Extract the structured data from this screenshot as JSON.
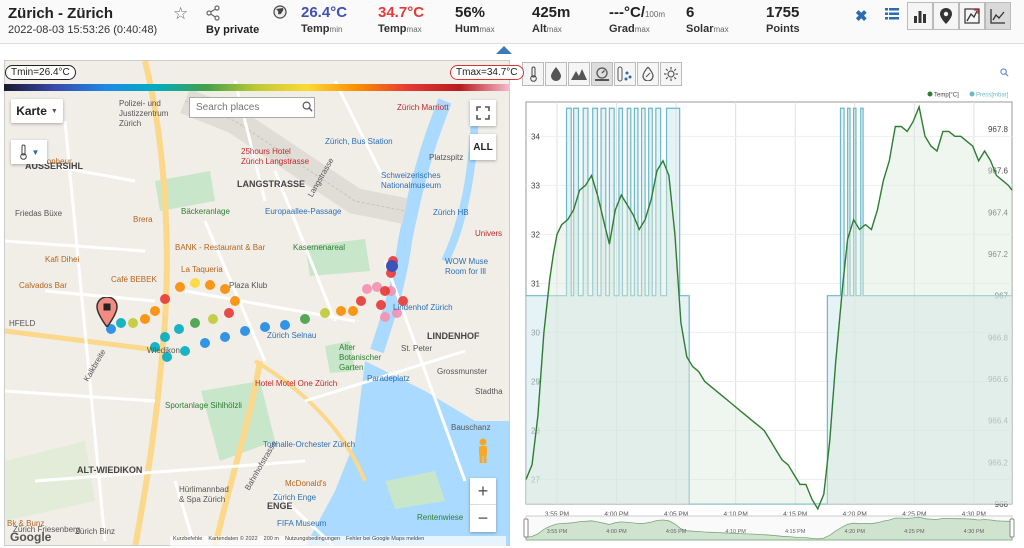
{
  "header": {
    "title": "Zürich - Zürich",
    "date": "2022-08-03 15:53:26 (0:40:48)",
    "by": "By private",
    "stats": [
      {
        "value": "26.4°C",
        "label": "Temp",
        "sub": "min",
        "color": "#3f51b5"
      },
      {
        "value": "34.7°C",
        "label": "Temp",
        "sub": "max",
        "color": "#e53935"
      },
      {
        "value": "56%",
        "label": "Hum",
        "sub": "max",
        "color": "#222222"
      },
      {
        "value": "425m",
        "label": "Alt",
        "sub": "max",
        "color": "#222222"
      },
      {
        "value": "---°C/",
        "unit": "100m",
        "label": "Grad",
        "sub": "max",
        "color": "#222222"
      },
      {
        "value": "6",
        "label": "Solar",
        "sub": "max",
        "color": "#222222"
      },
      {
        "value": "1755",
        "label": "Points",
        "sub": "",
        "color": "#222222"
      }
    ]
  },
  "map": {
    "tmin": "Tmin=26.4°C",
    "tmax": "Tmax=34.7°C",
    "karte_label": "Karte",
    "search_placeholder": "Search places",
    "all_label": "ALL",
    "google_label": "Google",
    "attribution": [
      "Kurzbefehle",
      "Kartendaten © 2022",
      "200 m",
      "Nutzungsbedingungen",
      "Fehler bei Google Maps melden"
    ],
    "labels": [
      {
        "t": "Polizei- und",
        "cls": ""
      },
      {
        "t": "Justizzentrum",
        "cls": ""
      },
      {
        "t": "Zürich",
        "cls": ""
      },
      {
        "t": "Zürich Marriott",
        "cls": "red"
      },
      {
        "t": "Zürich, Bus Station",
        "cls": "blue"
      },
      {
        "t": "Platzspitz",
        "cls": ""
      },
      {
        "t": "25hours Hotel",
        "cls": "red"
      },
      {
        "t": "Zürich Langstrasse",
        "cls": "red"
      },
      {
        "t": "AUSSERSIHL",
        "cls": "bold"
      },
      {
        "t": "LANGSTRASSE",
        "cls": "bold"
      },
      {
        "t": "Schweizerisches",
        "cls": "blue"
      },
      {
        "t": "Nationalmuseum",
        "cls": "blue"
      },
      {
        "t": "Du Bonheur",
        "cls": "poi"
      },
      {
        "t": "Friedas Büxe",
        "cls": ""
      },
      {
        "t": "Bäckeranlage",
        "cls": "green"
      },
      {
        "t": "Europaallee-Passage",
        "cls": "blue"
      },
      {
        "t": "Zürich HB",
        "cls": "blue"
      },
      {
        "t": "Brera",
        "cls": "poi"
      },
      {
        "t": "BANK - Restaurant & Bar",
        "cls": "poi"
      },
      {
        "t": "Kasernenareal",
        "cls": "green"
      },
      {
        "t": "Univers",
        "cls": "red"
      },
      {
        "t": "Kafi Dihei",
        "cls": "poi"
      },
      {
        "t": "La Taqueria",
        "cls": "poi"
      },
      {
        "t": "Café BEBEK",
        "cls": "poi"
      },
      {
        "t": "Plaza Klub",
        "cls": ""
      },
      {
        "t": "WOW Muse",
        "cls": "blue"
      },
      {
        "t": "Room for Ill",
        "cls": "blue"
      },
      {
        "t": "Calvados Bar",
        "cls": "poi"
      },
      {
        "t": "Lindenhof Zürich",
        "cls": "blue"
      },
      {
        "t": "LINDENHOF",
        "cls": "bold"
      },
      {
        "t": "Zürich Selnau",
        "cls": "blue"
      },
      {
        "t": "Alter",
        "cls": "green"
      },
      {
        "t": "Botanischer",
        "cls": "green"
      },
      {
        "t": "Garten",
        "cls": "green"
      },
      {
        "t": "St. Peter",
        "cls": ""
      },
      {
        "t": "Kalkbreite",
        "cls": ""
      },
      {
        "t": "Wiedikon",
        "cls": ""
      },
      {
        "t": "Paradeplatz",
        "cls": "blue"
      },
      {
        "t": "Grossmunster",
        "cls": ""
      },
      {
        "t": "Hotel Motel One Zürich",
        "cls": "red"
      },
      {
        "t": "Sportanlage Sihlhölzli",
        "cls": "green"
      },
      {
        "t": "Bauschanz",
        "cls": ""
      },
      {
        "t": "Tonhalle-Orchester Zürich",
        "cls": "blue"
      },
      {
        "t": "ALT-WIEDIKON",
        "cls": "bold"
      },
      {
        "t": "McDonald's",
        "cls": "poi"
      },
      {
        "t": "Hürlimannbad",
        "cls": ""
      },
      {
        "t": "& Spa Zürich",
        "cls": ""
      },
      {
        "t": "Zürich Enge",
        "cls": "blue"
      },
      {
        "t": "ENGE",
        "cls": "bold"
      },
      {
        "t": "Rentenwiese",
        "cls": "green"
      },
      {
        "t": "Zürich Friesenberg",
        "cls": ""
      },
      {
        "t": "Bk & Bunz",
        "cls": "poi"
      },
      {
        "t": "Zürich Binz",
        "cls": ""
      },
      {
        "t": "FIFA Museum",
        "cls": "blue"
      },
      {
        "t": "Bahnhofstrasse",
        "cls": ""
      },
      {
        "t": "Langstrasse",
        "cls": ""
      },
      {
        "t": "HFELD",
        "cls": ""
      },
      {
        "t": "Stadtha",
        "cls": ""
      }
    ]
  },
  "chart_data": {
    "type": "line",
    "title": "",
    "legend": [
      "Temp[°C]",
      "Press[mbar]"
    ],
    "legend_position": "top-right",
    "series_colors": {
      "temp": "#2e7d32",
      "press": "#6cb8c9"
    },
    "x_ticks": [
      "3:55 PM",
      "4:00 PM",
      "4:05 PM",
      "4:10 PM",
      "4:15 PM",
      "4:20 PM",
      "4:25 PM",
      "4:30 PM"
    ],
    "x_range_minutes": [
      0,
      40.8
    ],
    "y_left": {
      "label": "Temp[°C]",
      "ticks": [
        27,
        28,
        29,
        30,
        31,
        32,
        33,
        34
      ],
      "range": [
        26.5,
        34.7
      ]
    },
    "y_right": {
      "label": "Press[mbar]",
      "ticks": [
        966,
        966.2,
        966.4,
        966.6,
        966.8,
        967,
        967.2,
        967.4,
        967.6,
        967.8
      ],
      "range": [
        966,
        967.93
      ]
    },
    "series": [
      {
        "name": "Temp[°C]",
        "axis": "left",
        "t": [
          0,
          0.5,
          1,
          1.5,
          2,
          2.3,
          2.6,
          3,
          3.5,
          4,
          4.5,
          5,
          5.5,
          6,
          6.5,
          7,
          7.5,
          8,
          8.5,
          9,
          9.5,
          10,
          10.5,
          11,
          11.5,
          12,
          12.5,
          13,
          13.5,
          14,
          14.5,
          15,
          15.5,
          16,
          16.5,
          17,
          17.5,
          18,
          18.5,
          19,
          19.5,
          20,
          20.5,
          21,
          21.5,
          22,
          22.5,
          23,
          23.5,
          24,
          24.5,
          25,
          25.5,
          26,
          26.3,
          26.6,
          27,
          27.5,
          28,
          28.5,
          29,
          29.5,
          30,
          30.5,
          31,
          31.5,
          32,
          32.5,
          33,
          33.5,
          34,
          34.5,
          35,
          35.5,
          36,
          36.5,
          37,
          37.5,
          38,
          38.5,
          39,
          39.5,
          40,
          40.5,
          40.8
        ],
        "v": [
          27.0,
          27.3,
          28.3,
          30.0,
          31.1,
          31.6,
          32.0,
          32.2,
          32.3,
          32.5,
          32.9,
          33.0,
          33.2,
          32.8,
          32.3,
          31.8,
          32.5,
          32.8,
          32.6,
          32.4,
          32.1,
          32.3,
          32.7,
          33.3,
          33.5,
          33.2,
          32.0,
          30.2,
          29.5,
          29.3,
          29.2,
          29.0,
          28.9,
          28.8,
          28.7,
          28.6,
          28.5,
          28.4,
          28.3,
          28.2,
          28.1,
          28.0,
          27.8,
          27.6,
          27.4,
          27.3,
          27.1,
          26.9,
          26.9,
          26.6,
          26.4,
          26.7,
          27.8,
          29.4,
          30.2,
          31.0,
          31.9,
          32.3,
          32.1,
          32.2,
          32.1,
          32.5,
          33.1,
          33.5,
          34.2,
          34.2,
          34.1,
          34.3,
          34.6,
          34.0,
          33.8,
          33.7,
          34.1,
          34.1,
          34.0,
          34.0,
          33.9,
          33.8,
          33.5,
          33.7,
          33.5,
          33.2,
          33.1,
          33.0,
          32.9
        ]
      },
      {
        "name": "Press[mbar]",
        "axis": "right",
        "steps": [
          [
            0,
            967
          ],
          [
            3.3,
            967
          ],
          [
            3.4,
            967.9
          ],
          [
            3.8,
            967
          ],
          [
            4.0,
            967.9
          ],
          [
            4.4,
            967
          ],
          [
            4.8,
            967.9
          ],
          [
            5.2,
            967
          ],
          [
            5.6,
            967.9
          ],
          [
            6.0,
            967
          ],
          [
            6.3,
            967.9
          ],
          [
            6.7,
            967
          ],
          [
            7.0,
            967.9
          ],
          [
            7.4,
            967
          ],
          [
            7.8,
            967.9
          ],
          [
            8.1,
            967
          ],
          [
            8.5,
            967.9
          ],
          [
            8.8,
            967
          ],
          [
            9.1,
            967.9
          ],
          [
            9.4,
            967
          ],
          [
            9.7,
            967.9
          ],
          [
            10.0,
            967
          ],
          [
            10.3,
            967.9
          ],
          [
            10.6,
            967
          ],
          [
            10.9,
            967.9
          ],
          [
            11.3,
            967
          ],
          [
            11.6,
            967
          ],
          [
            11.8,
            967.9
          ],
          [
            12.8,
            967.9
          ],
          [
            12.9,
            967
          ],
          [
            13.6,
            967
          ],
          [
            13.7,
            966
          ],
          [
            25.2,
            966
          ],
          [
            25.3,
            967
          ],
          [
            26.3,
            967
          ],
          [
            26.4,
            967.9
          ],
          [
            26.7,
            967
          ],
          [
            27.0,
            967.9
          ],
          [
            27.2,
            967
          ],
          [
            27.5,
            967.9
          ],
          [
            27.7,
            967
          ],
          [
            28.1,
            967.9
          ],
          [
            28.3,
            967
          ],
          [
            40.8,
            967
          ]
        ]
      }
    ]
  }
}
